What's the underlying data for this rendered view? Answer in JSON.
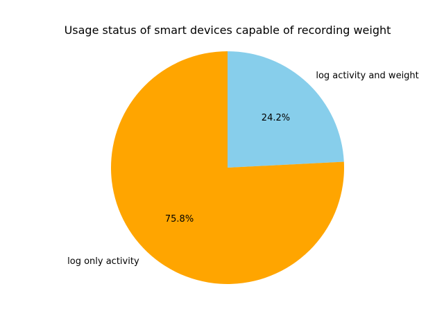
{
  "chart_data": {
    "type": "pie",
    "title": "Usage status of smart devices capable of recording weight",
    "slices": [
      {
        "label": "log activity and weight",
        "value": 24.2,
        "pct_label": "24.2%",
        "color": "#87CEEB"
      },
      {
        "label": "log only activity",
        "value": 75.8,
        "pct_label": "75.8%",
        "color": "#FFA500"
      }
    ],
    "start_angle_deg": 90,
    "direction": "clockwise"
  }
}
